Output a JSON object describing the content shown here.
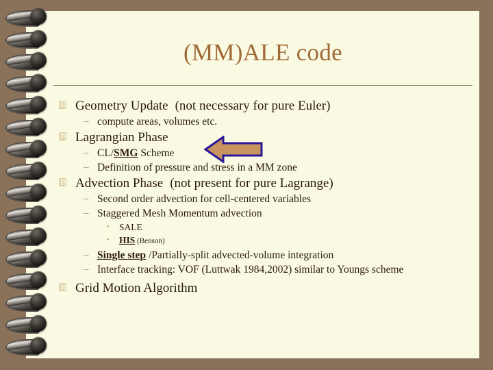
{
  "slide": {
    "title": "(MM)ALE code",
    "title_color": "#a06a37",
    "page_color": "#fafae2",
    "background_color": "#8a7159",
    "text_color": "#2b1a08"
  },
  "callout_arrow": {
    "direction": "left",
    "fill_color": "#c9935f",
    "outline_color": "#2a1a9a",
    "points_at": "CL/SMG Scheme"
  },
  "bullets": {
    "geometry_update": {
      "level": 1,
      "text": "Geometry Update",
      "note": "(not necessary for pure Euler)"
    },
    "compute_areas": {
      "level": 2,
      "text": "compute areas, volumes etc."
    },
    "lagrangian_phase": {
      "level": 1,
      "text": "Lagrangian Phase"
    },
    "cl_smg": {
      "level": 2,
      "prefix": "CL/",
      "emphasis": "SMG",
      "suffix": " Scheme"
    },
    "definition_pressure": {
      "level": 2,
      "text": "Definition of pressure and stress in a MM zone"
    },
    "advection_phase": {
      "level": 1,
      "text": "Advection Phase",
      "note": "(not present for pure Lagrange)"
    },
    "second_order": {
      "level": 2,
      "text": "Second order advection for cell-centered  variables"
    },
    "staggered_mesh": {
      "level": 2,
      "text": "Staggered Mesh Momentum advection"
    },
    "sale": {
      "level": 3,
      "text": "SALE"
    },
    "his": {
      "level": 3,
      "emphasis": "HIS",
      "suffix": " (Benson)"
    },
    "single_step": {
      "level": 2,
      "emphasis": "Single step",
      "suffix": " /Partially-split advected-volume integration"
    },
    "interface_tracking": {
      "level": 2,
      "text": "Interface tracking:  VOF  (Luttwak 1984,2002) similar to Youngs  scheme"
    },
    "grid_motion": {
      "level": 1,
      "text": "Grid Motion Algorithm"
    }
  },
  "markers": {
    "level1_icon": "lined-document-icon",
    "level2_glyph": "–",
    "level3_glyph": "•"
  }
}
